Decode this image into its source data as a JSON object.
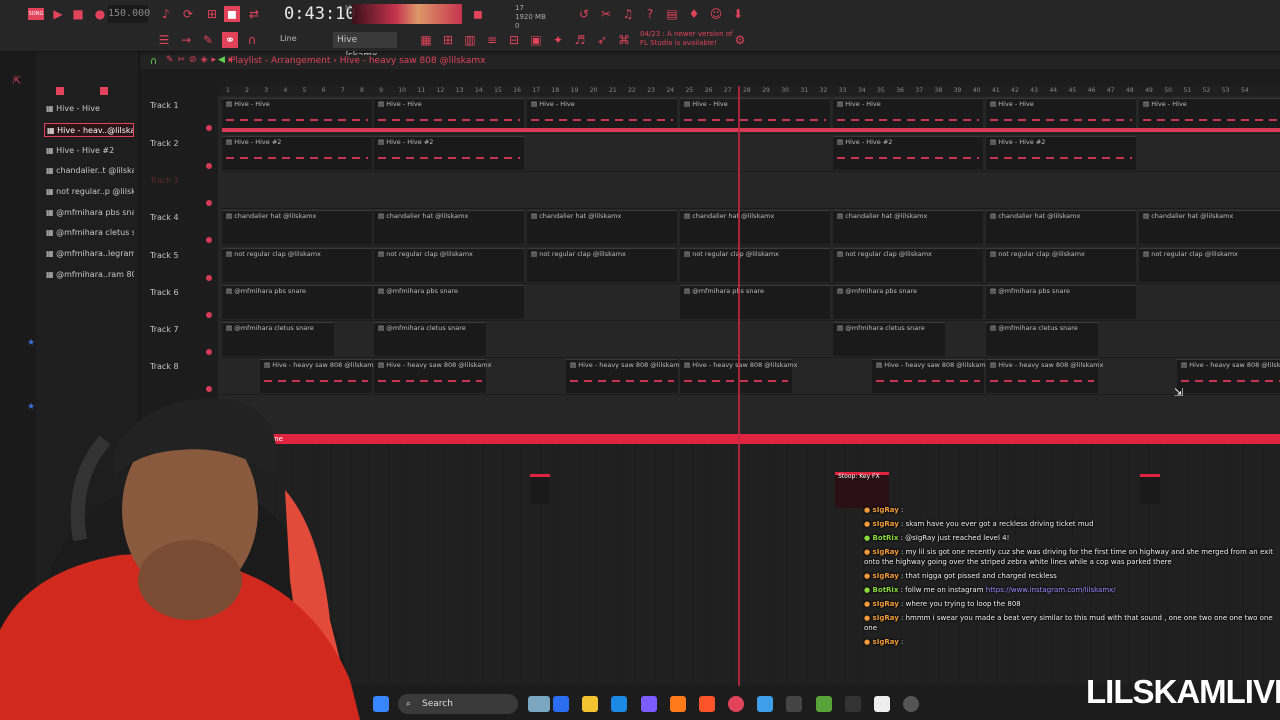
{
  "toolbar": {
    "song_mode": "SONG",
    "tempo": "150.000",
    "time": "0:43:10",
    "time_sub": "M:S:CS",
    "cpu_top": "17",
    "cpu_mem": "1920 MB",
    "cpu_bottom": "0",
    "snap": "Line",
    "pattern": "Hive ...lskamx",
    "news_line1": "04/23 : A newer version of",
    "news_line2": "FL Studio is available!"
  },
  "playlist": {
    "title": "Playlist - Arrangement",
    "separator": "›",
    "clip": "Hive - heavy saw 808 @lilskamx",
    "ruler": [
      "1",
      "2",
      "3",
      "4",
      "5",
      "6",
      "7",
      "8",
      "9",
      "10",
      "11",
      "12",
      "13",
      "14",
      "15",
      "16",
      "17",
      "18",
      "19",
      "20",
      "21",
      "22",
      "23",
      "24",
      "25",
      "26",
      "27",
      "28",
      "29",
      "30",
      "31",
      "32",
      "33",
      "34",
      "35",
      "36",
      "37",
      "38",
      "39",
      "40",
      "41",
      "42",
      "43",
      "44",
      "45",
      "46",
      "47",
      "48",
      "49",
      "50",
      "51",
      "52",
      "53",
      "54"
    ],
    "tracks": [
      {
        "label": "Track 1",
        "clips": [
          {
            "name": "Hive - Hive"
          },
          {
            "name": "Hive - Hive"
          },
          {
            "name": "Hive - Hive"
          },
          {
            "name": "Hive - Hive"
          },
          {
            "name": "Hive - Hive"
          },
          {
            "name": "Hive - Hive"
          },
          {
            "name": "Hive - Hive"
          }
        ]
      },
      {
        "label": "Track 2",
        "clips": [
          {
            "name": "Hive - Hive #2"
          },
          {
            "name": "Hive - Hive #2"
          },
          {
            "name": "Hive - Hive #2"
          },
          {
            "name": "Hive - Hive #2"
          }
        ]
      },
      {
        "label": "Track 3",
        "clips": []
      },
      {
        "label": "Track 4",
        "clips": [
          {
            "name": "chandalier hat @lilskamx"
          },
          {
            "name": "chandalier hat @lilskamx"
          },
          {
            "name": "chandalier hat @lilskamx"
          },
          {
            "name": "chandalier hat @lilskamx"
          },
          {
            "name": "chandalier hat @lilskamx"
          },
          {
            "name": "chandalier hat @lilskamx"
          },
          {
            "name": "chandalier hat @lilskamx"
          }
        ]
      },
      {
        "label": "Track 5",
        "clips": [
          {
            "name": "not regular clap @lilskamx"
          },
          {
            "name": "not regular clap @lilskamx"
          },
          {
            "name": "not regular clap @lilskamx"
          },
          {
            "name": "not regular clap @lilskamx"
          },
          {
            "name": "not regular clap @lilskamx"
          },
          {
            "name": "not regular clap @lilskamx"
          },
          {
            "name": "not regular clap @lilskamx"
          }
        ]
      },
      {
        "label": "Track 6",
        "clips": [
          {
            "name": "@mfmihara pbs snare"
          },
          {
            "name": "@mfmihara pbs snare"
          },
          {
            "name": "@mfmihara pbs snare"
          },
          {
            "name": "@mfmihara pbs snare"
          },
          {
            "name": "@mfmihara pbs snare"
          }
        ]
      },
      {
        "label": "Track 7",
        "clips": [
          {
            "name": "@mfmihara cletus snare"
          },
          {
            "name": "@mfmihara cletus snare"
          },
          {
            "name": "@mfmihara cletus snare"
          },
          {
            "name": "@mfmihara cletus snare"
          }
        ]
      },
      {
        "label": "Track 8",
        "clips": [
          {
            "name": "Hive - heavy saw 808 @lilskamx"
          },
          {
            "name": "Hive - heavy saw 808 @lilskamx"
          },
          {
            "name": "Hive - heavy saw 808 @lilskamx"
          },
          {
            "name": "Hive - heavy saw 808 @lilskamx"
          },
          {
            "name": "Hive - heavy saw 808 @lilskamx"
          },
          {
            "name": "Hive - heavy saw 808 @lilskamx"
          },
          {
            "name": "Hive - heavy saw 808 @lilskamx"
          }
        ]
      }
    ],
    "automation_label": "ter - Volume",
    "fx_clip": "Stoop: Key FX"
  },
  "browser": {
    "patterns": [
      "Hive - Hive",
      "Hive - heav..@lilskamx",
      "Hive - Hive #2",
      "chandalier..t @lilskamx",
      "not regular..p @lilskamx",
      "@mfmihara pbs snare",
      "@mfmihara cletus snare",
      "@mfmihara..legram 808",
      "@mfmihara..ram 808 #2"
    ]
  },
  "chat": [
    {
      "user": "sIgRay",
      "text": ""
    },
    {
      "user": "sIgRay",
      "text": "skam have you ever got a reckless driving ticket mud"
    },
    {
      "user": "BotRix",
      "text": "@sIgRay just reached level 4!"
    },
    {
      "user": "sIgRay",
      "text": "my lil sis got one recently cuz she was driving for the first time on highway and she merged from an exit onto the highway going over the striped zebra white lines while a cop was parked there"
    },
    {
      "user": "sIgRay",
      "text": "that nigga got pissed and charged reckless"
    },
    {
      "user": "BotRix",
      "text": "follw me on instagram",
      "link": "https://www.instagram.com/lilskamx/"
    },
    {
      "user": "sIgRay",
      "text": "where you trying to loop the 808"
    },
    {
      "user": "sIgRay",
      "text": "hmmm i swear you made a beat very similar to this mud with that sound , one one two one one two one one"
    },
    {
      "user": "sIgRay",
      "text": ""
    }
  ],
  "taskbar": {
    "search": "Search"
  },
  "brand": "LILSKAMLIVE",
  "colors": {
    "accent": "#e0435a",
    "background": "#262626",
    "automation": "#e0233f"
  }
}
